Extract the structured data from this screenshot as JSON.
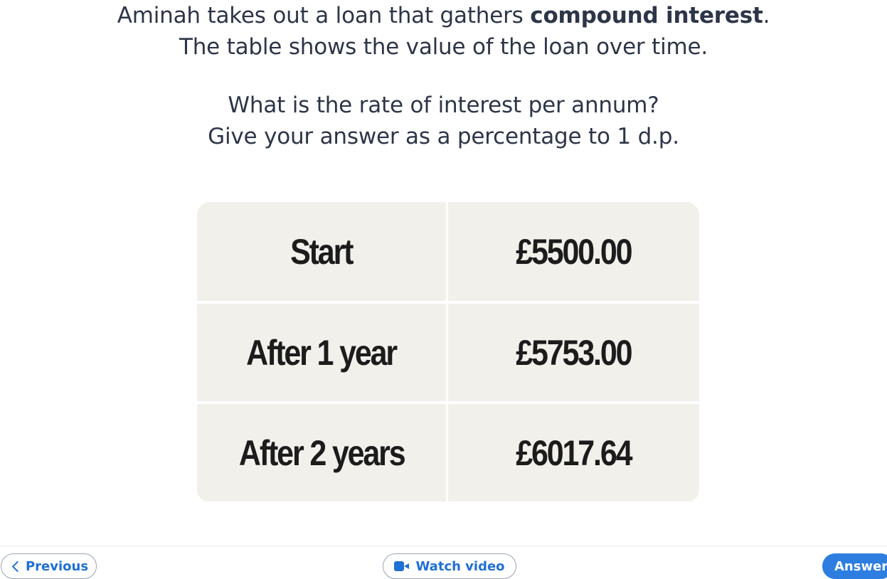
{
  "question": {
    "line1_pre": "Aminah takes out a loan that gathers ",
    "line1_bold": "compound interest",
    "line1_post": ".",
    "line2": "The table shows the value of the loan over time.",
    "line3": "What is the rate of interest per annum?",
    "line4": "Give your answer as a percentage to 1 d.p."
  },
  "table": {
    "rows": [
      {
        "label": "Start",
        "value": "£5500.00"
      },
      {
        "label": "After 1 year",
        "value": "£5753.00"
      },
      {
        "label": "After 2 years",
        "value": "£6017.64"
      }
    ]
  },
  "footer": {
    "previous_label": "Previous",
    "watch_video_label": "Watch video",
    "answer_label": "Answer",
    "icons": {
      "previous": "chevron-left-icon",
      "watch_video": "video-camera-icon"
    }
  },
  "colors": {
    "text": "#2d3548",
    "table_cell": "#f2f0eb",
    "accent": "#1f6fd6",
    "answer_button": "#2e7de0"
  }
}
